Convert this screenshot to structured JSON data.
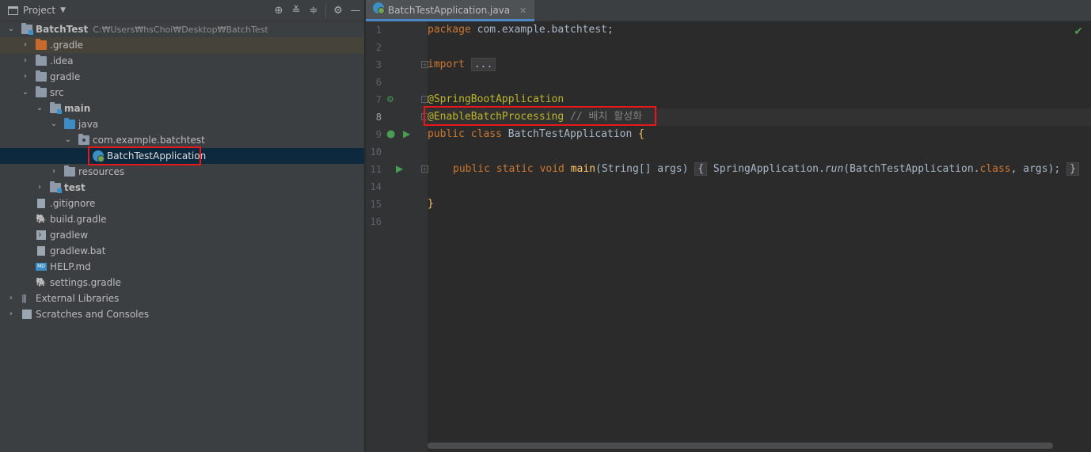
{
  "project_panel": {
    "title": "Project",
    "tree": [
      {
        "label": "BatchTest",
        "path": "C:₩Users₩hsChoi₩Desktop₩BatchTest"
      },
      {
        "label": ".gradle"
      },
      {
        "label": ".idea"
      },
      {
        "label": "gradle"
      },
      {
        "label": "src"
      },
      {
        "label": "main"
      },
      {
        "label": "java"
      },
      {
        "label": "com.example.batchtest"
      },
      {
        "label": "BatchTestApplication"
      },
      {
        "label": "resources"
      },
      {
        "label": "test"
      },
      {
        "label": ".gitignore"
      },
      {
        "label": "build.gradle"
      },
      {
        "label": "gradlew"
      },
      {
        "label": "gradlew.bat"
      },
      {
        "label": "HELP.md"
      },
      {
        "label": "settings.gradle"
      },
      {
        "label": "External Libraries"
      },
      {
        "label": "Scratches and Consoles"
      }
    ]
  },
  "editor": {
    "tab_label": "BatchTestApplication.java",
    "line_numbers": [
      "1",
      "2",
      "3",
      "6",
      "7",
      "8",
      "9",
      "10",
      "11",
      "14",
      "15",
      "16"
    ],
    "code": {
      "l1_kw": "package",
      "l1_rest": " com.example.batchtest;",
      "l3_kw": "import",
      "l3_fold": "...",
      "l7_ann": "@SpringBootApplication",
      "l8_ann": "@EnableBatchProcessing",
      "l8_comment": " // 배치 활성화",
      "l9_kw": "public class",
      "l9_name": " BatchTestApplication ",
      "l9_brace": "{",
      "l11_kw": "public static void",
      "l11_fn": "main",
      "l11_params": "(String[] args)",
      "l11_open": "{",
      "l11_call1": " SpringApplication.",
      "l11_run": "run",
      "l11_call2": "(BatchTestApplication.",
      "l11_class": "class",
      "l11_call3": ", args);",
      "l11_close": "}",
      "l15_brace": "}"
    }
  },
  "colors": {
    "keyword": "#cc7832",
    "annotation": "#bbb529",
    "function": "#ffc66d",
    "comment": "#808080",
    "highlight_box": "#e5191b"
  },
  "icons": [
    "project-icon",
    "locate-icon",
    "expand-all-icon",
    "collapse-all-icon",
    "gear-icon",
    "minimize-icon",
    "spring-boot-icon",
    "run-icon",
    "check-icon"
  ]
}
